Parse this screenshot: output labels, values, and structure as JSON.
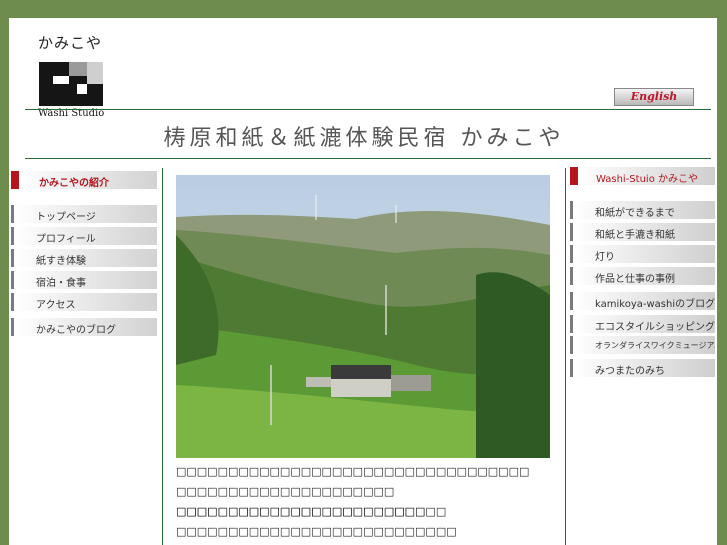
{
  "header": {
    "logo_kana": "かみこや",
    "logo_subtitle": "Washi Studio",
    "english_label": "English",
    "site_title": "梼原和紙＆紙漉体験民宿 かみこや"
  },
  "left_nav": {
    "intro_label": "かみこやの紹介",
    "items": [
      {
        "label": "トップページ"
      },
      {
        "label": "プロフィール"
      },
      {
        "label": "紙すき体験"
      },
      {
        "label": "宿泊・食事"
      },
      {
        "label": "アクセス"
      },
      {
        "label": "かみこやのブログ"
      }
    ]
  },
  "main": {
    "paragraph_1": "□□□□□□□□□□□□□□□□□□□□□□□□□□□□□□□□□□ □□□□□□□□□□□□□□□□□□□□□ □□□□□□□□□□□□□□□□□□□□□□□□□□",
    "paragraph_2": "□□□□□□□□□□□□□□□□□□□□□□□□ □□□□□□□□□□□□□□□□□□□□□□□□□□□ □□□□□□□□□□□□□□□□□□□□□□□□□□□□□"
  },
  "right_nav": {
    "header_label": "Washi-Stuio かみこや",
    "items": [
      {
        "label": "和紙ができるまで"
      },
      {
        "label": "和紙と手漉き和紙"
      },
      {
        "label": "灯り"
      },
      {
        "label": "作品と仕事の事例"
      },
      {
        "label": "kamikoya-washiのブログ"
      },
      {
        "label": "エコスタイルショッピング"
      },
      {
        "label": "オランダライスワイクミュージアム"
      },
      {
        "label": "みつまたのみち"
      }
    ]
  },
  "colors": {
    "page_background": "#6f8c4f",
    "accent_red": "#b3161d",
    "rule_green": "#2e6b3b"
  }
}
